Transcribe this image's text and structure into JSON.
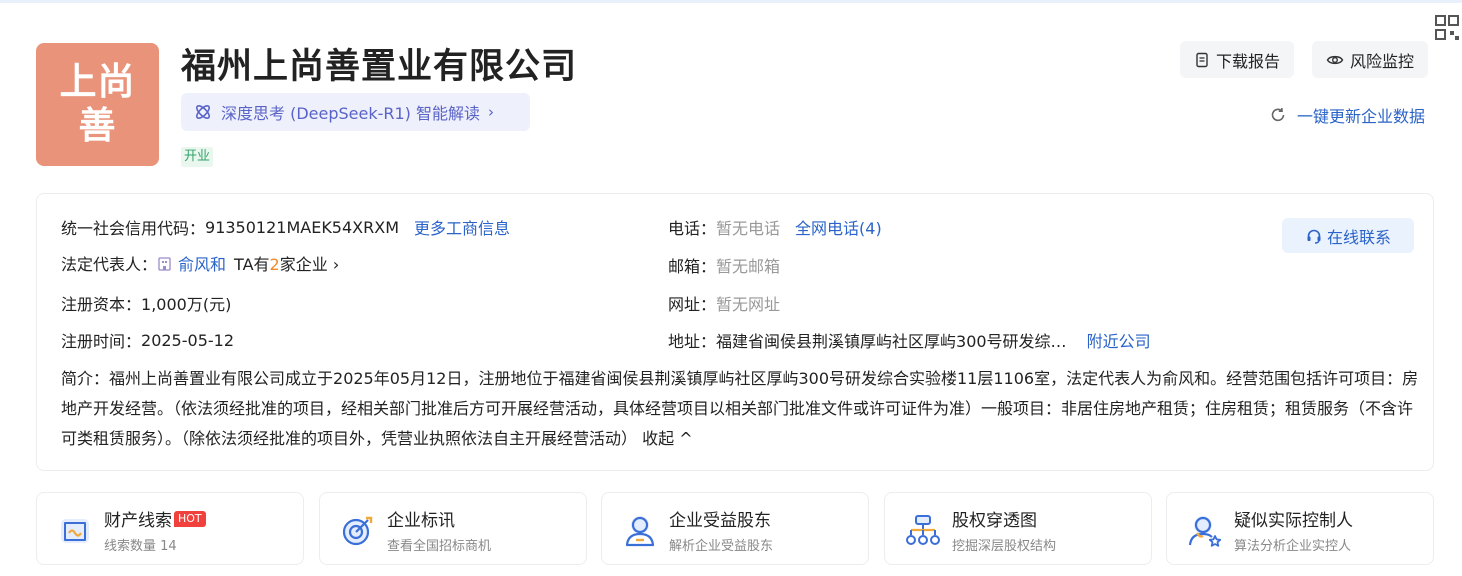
{
  "company": {
    "logo_text": "上尚善",
    "name": "福州上尚善置业有限公司",
    "ai_link": "深度思考 (DeepSeek-R1) 智能解读",
    "status": "开业"
  },
  "header_actions": {
    "download": "下载报告",
    "monitor": "风险监控",
    "refresh": "一键更新企业数据"
  },
  "info": {
    "credit_code_label": "统一社会信用代码：",
    "credit_code": "91350121MAEK54XRXM",
    "more_business": "更多工商信息",
    "legal_rep_label": "法定代表人：",
    "legal_rep": "俞风和",
    "ta_prefix": "TA有",
    "ta_count": "2",
    "ta_suffix": "家企业",
    "capital_label": "注册资本：",
    "capital": "1,000万(元)",
    "reg_time_label": "注册时间：",
    "reg_time": "2025-05-12",
    "phone_label": "电话：",
    "phone": "暂无电话",
    "all_phones": "全网电话(4)",
    "email_label": "邮箱：",
    "email": "暂无邮箱",
    "website_label": "网址：",
    "website": "暂无网址",
    "address_label": "地址：",
    "address": "福建省闽侯县荆溪镇厚屿社区厚屿300号研发综…",
    "nearby": "附近公司",
    "online_contact": "在线联系",
    "intro_label": "简介：",
    "intro_text": "福州上尚善置业有限公司成立于2025年05月12日，注册地位于福建省闽侯县荆溪镇厚屿社区厚屿300号研发综合实验楼11层1106室，法定代表人为俞风和。经营范围包括许可项目：房地产开发经营。（依法须经批准的项目，经相关部门批准后方可开展经营活动，具体经营项目以相关部门批准文件或许可证件为准）一般项目：非居住房地产租赁；住房租赁；租赁服务（不含许可类租赁服务）。（除依法须经批准的项目外，凭营业执照依法自主开展经营活动）",
    "collapse": "收起"
  },
  "features": [
    {
      "title": "财产线索",
      "badge": "HOT",
      "sub": "线索数量 14",
      "icon": "wallet-icon"
    },
    {
      "title": "企业标讯",
      "sub": "查看全国招标商机",
      "icon": "target-icon"
    },
    {
      "title": "企业受益股东",
      "sub": "解析企业受益股东",
      "icon": "person-icon"
    },
    {
      "title": "股权穿透图",
      "sub": "挖掘深层股权结构",
      "icon": "org-chart-icon"
    },
    {
      "title": "疑似实际控制人",
      "sub": "算法分析企业实控人",
      "icon": "person-star-icon"
    }
  ],
  "colors": {
    "logo_bg": "#e8937a",
    "link": "#2a63c9",
    "ai_purple": "#5a63c7",
    "status_green": "#33a36b",
    "hot_red": "#f0413d",
    "icon_blue": "#3b6fd8"
  }
}
